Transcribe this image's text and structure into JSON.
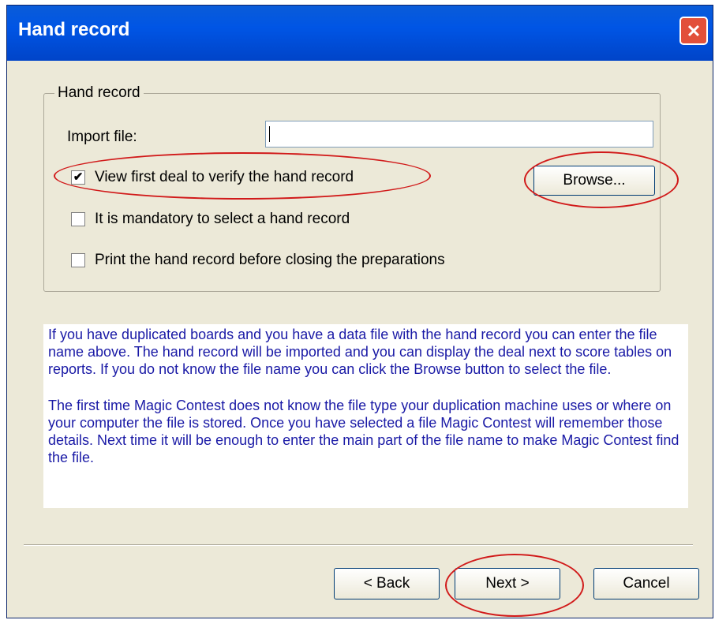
{
  "window": {
    "title": "Hand record",
    "close_symbol": "✕"
  },
  "group": {
    "label": "Hand record",
    "import_label": "Import file:",
    "import_value": "",
    "browse_label": "Browse...",
    "checkboxes": [
      {
        "label": "View first deal to verify the hand record",
        "checked": true
      },
      {
        "label": "It is mandatory to select a hand record",
        "checked": false
      },
      {
        "label": "Print the hand record before closing the preparations",
        "checked": false
      }
    ]
  },
  "info": {
    "paragraphs": [
      "If you have duplicated boards and you have a data file with the hand record you can enter the file name above. The hand record will be imported and you can display the deal next to score tables on reports. If you do not know the file name you can click the Browse button to select the file.",
      "The first time Magic Contest does not know the file type your duplication machine uses or where on your computer the file is stored. Once you have selected a file Magic Contest will remember those details. Next time it will be enough to enter the main part of the file name to make Magic Contest find the file."
    ]
  },
  "buttons": {
    "back": "< Back",
    "next": "Next >",
    "cancel": "Cancel"
  },
  "colors": {
    "annotation": "#d11a1a",
    "info_text": "#1a1aa6",
    "titlebar": "#0055e5"
  }
}
